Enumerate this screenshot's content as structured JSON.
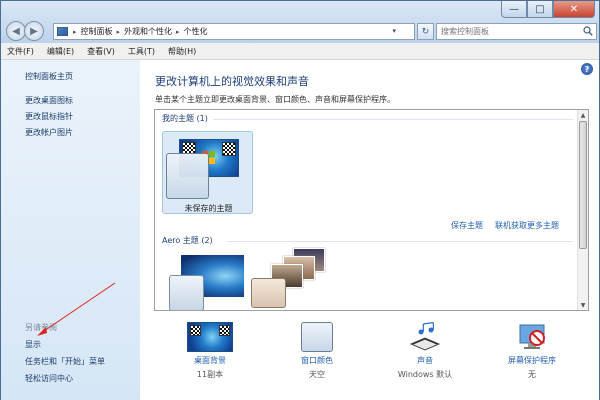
{
  "window": {
    "minimize_glyph": "—",
    "maximize_glyph": "□",
    "close_glyph": "✕"
  },
  "nav": {
    "back_glyph": "◀",
    "forward_glyph": "▶"
  },
  "address": {
    "crumbs": [
      "控制面板",
      "外观和个性化",
      "个性化"
    ],
    "separator": "▸",
    "dropdown_glyph": "▾",
    "refresh_glyph": "↻"
  },
  "search": {
    "placeholder": "搜索控制面板"
  },
  "menu": {
    "items": [
      "文件(F)",
      "编辑(E)",
      "查看(V)",
      "工具(T)",
      "帮助(H)"
    ]
  },
  "sidebar": {
    "items": [
      "控制面板主页",
      "更改桌面图标",
      "更改鼠标指针",
      "更改帐户图片"
    ],
    "see_also_heading": "另请参阅",
    "see_also": [
      "显示",
      "任务栏和「开始」菜单",
      "轻松访问中心"
    ]
  },
  "main": {
    "help_glyph": "?",
    "title": "更改计算机上的视觉效果和声音",
    "description": "单击某个主题立即更改桌面背景、窗口颜色、声音和屏幕保护程序。",
    "my_themes_label": "我的主题 (1)",
    "unsaved_theme": "未保存的主题",
    "save_theme": "保存主题",
    "get_more_themes": "联机获取更多主题",
    "aero_themes_label": "Aero 主题 (2)"
  },
  "bottom_options": [
    {
      "label": "桌面背景",
      "value": "11副本"
    },
    {
      "label": "窗口颜色",
      "value": "天空"
    },
    {
      "label": "声音",
      "value": "Windows 默认"
    },
    {
      "label": "屏幕保护程序",
      "value": "无"
    }
  ],
  "colors": {
    "link": "#1f5fb0",
    "title_blue": "#1e3f7a",
    "annotation_arrow": "#e02020"
  },
  "icons": [
    "search-icon",
    "help-icon",
    "windows-flag-icon",
    "music-notes-icon",
    "screensaver-no-icon",
    "control-panel-icon"
  ]
}
